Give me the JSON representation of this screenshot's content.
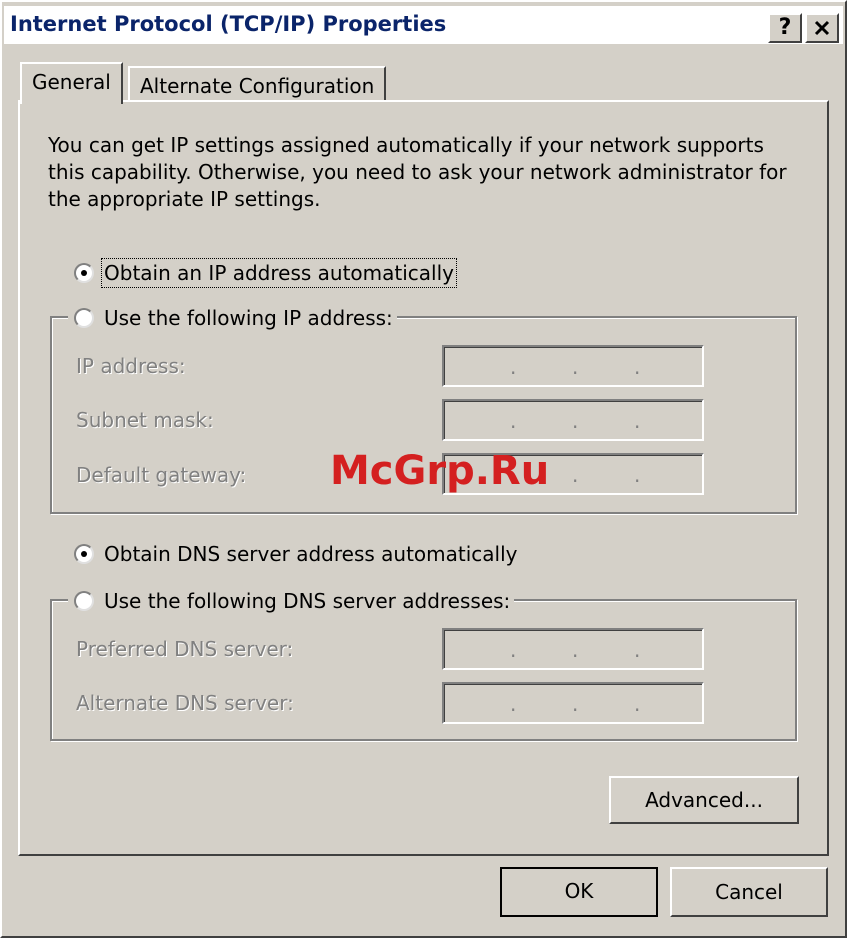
{
  "window": {
    "title": "Internet Protocol (TCP/IP) Properties",
    "help_button": "?",
    "close_button": "✕"
  },
  "tabs": [
    {
      "label": "General",
      "active": true
    },
    {
      "label": "Alternate Configuration",
      "active": false
    }
  ],
  "intro_text": "You can get IP settings assigned automatically if your network supports this capability. Otherwise, you need to ask your network administrator for the appropriate IP settings.",
  "ip_section": {
    "auto_option": {
      "label": "Obtain an IP address automatically",
      "checked": true
    },
    "manual_option": {
      "label": "Use the following IP address:",
      "checked": false
    },
    "fields": [
      {
        "label": "IP address:",
        "value": ". . ."
      },
      {
        "label": "Subnet mask:",
        "value": ". . ."
      },
      {
        "label": "Default gateway:",
        "value": ". . ."
      }
    ]
  },
  "dns_section": {
    "auto_option": {
      "label": "Obtain DNS server address automatically",
      "checked": true
    },
    "manual_option": {
      "label": "Use the following DNS server addresses:",
      "checked": false
    },
    "fields": [
      {
        "label": "Preferred DNS server:",
        "value": ". . ."
      },
      {
        "label": "Alternate DNS server:",
        "value": ". . ."
      }
    ]
  },
  "buttons": {
    "advanced": "Advanced...",
    "ok": "OK",
    "cancel": "Cancel"
  },
  "watermark": "McGrp.Ru",
  "colors": {
    "dialog_bg": "#d4d0c8",
    "title_text": "#0a246a",
    "disabled_text": "#808080",
    "watermark": "#d42020"
  }
}
